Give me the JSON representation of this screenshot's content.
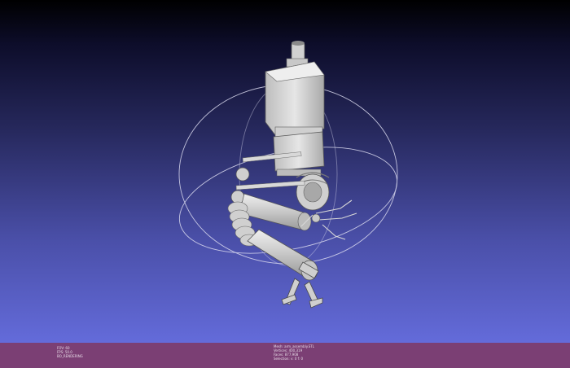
{
  "status": {
    "left_lines": [
      "FOV: 60",
      "FPS:    50.0",
      "BO_RENDERING"
    ],
    "right_lines": [
      "Mesh: arm_assembly.STL",
      "Vertices: 400,319",
      "Faces: 877,908",
      "Selection: v: 0 f: 0"
    ]
  },
  "colors": {
    "bg_top": "#000000",
    "bg_bottom": "#6a72e6",
    "statusbar": "#7b3f74",
    "model": "#d6d6d6",
    "trackball": "#e0e0ee"
  },
  "icons": {
    "trackball": "trackball-icon",
    "model": "robot-arm-model"
  }
}
